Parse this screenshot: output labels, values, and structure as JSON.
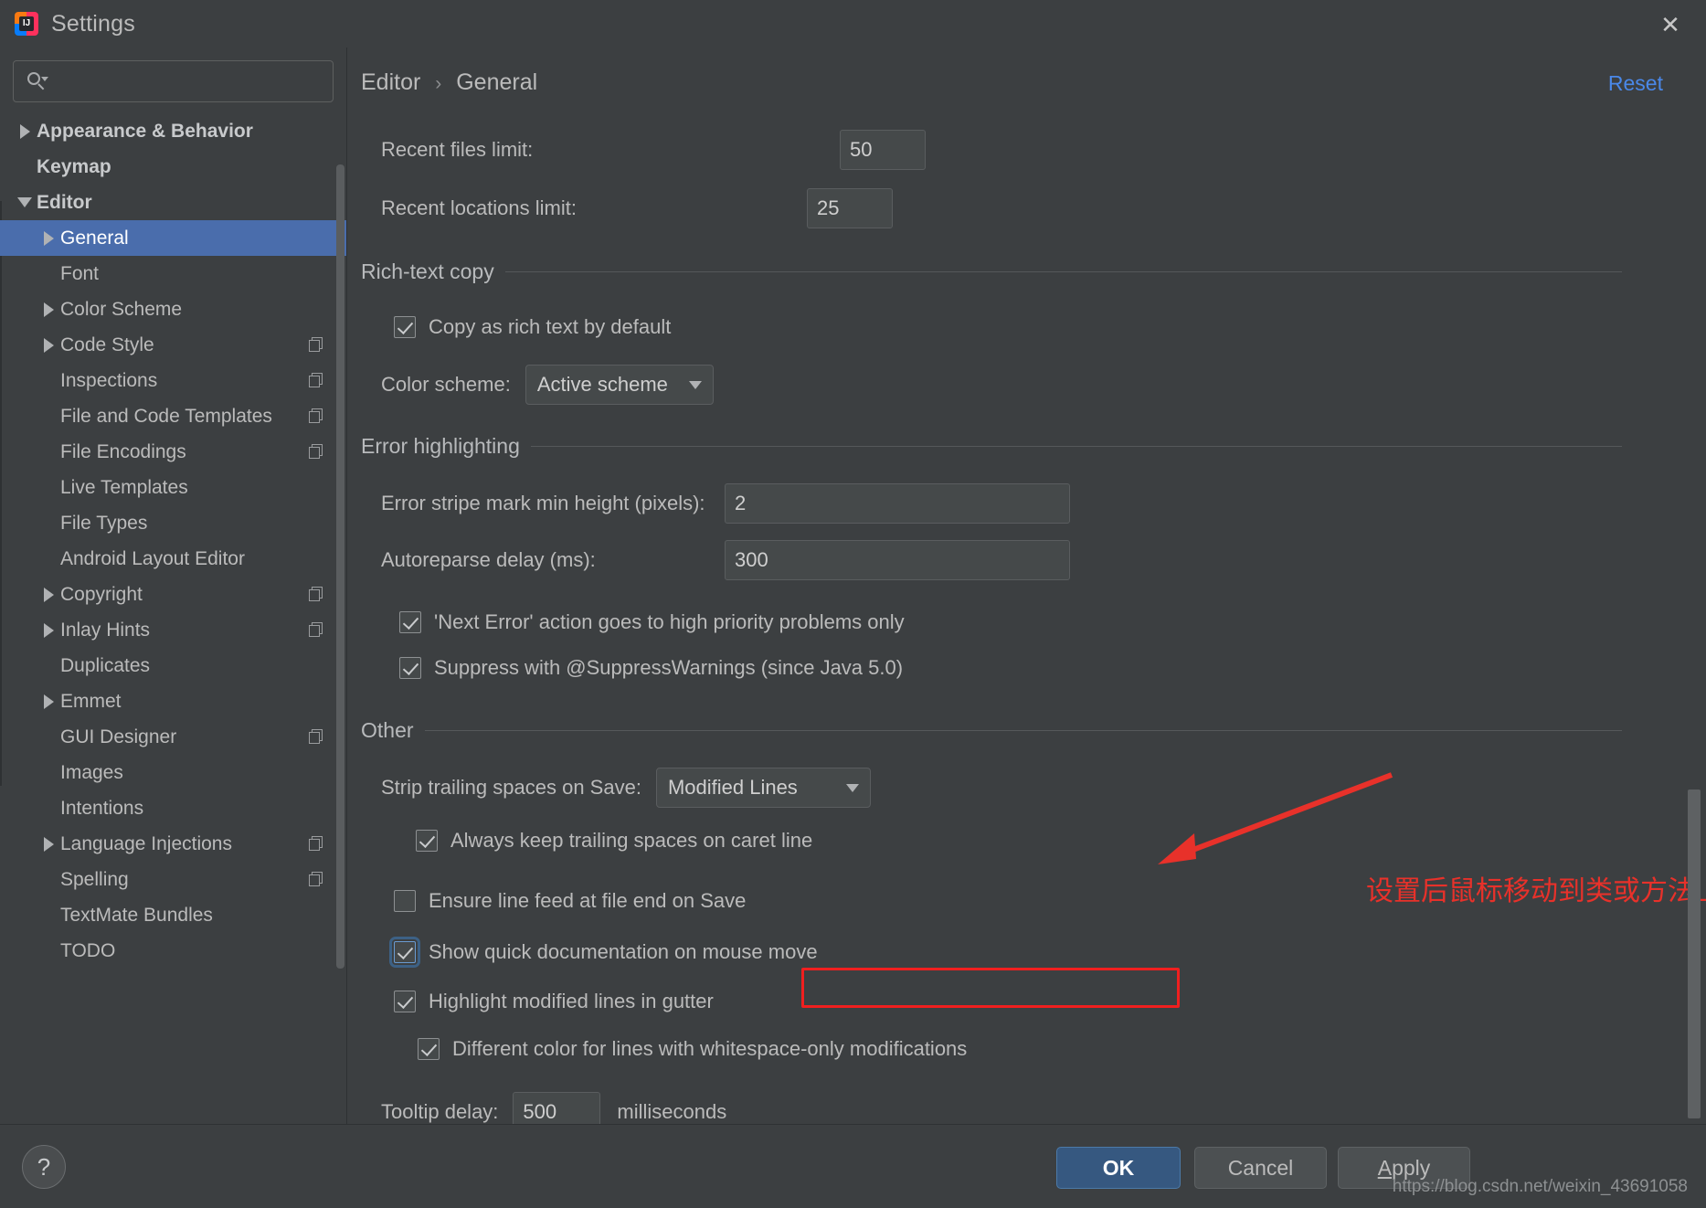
{
  "window": {
    "title": "Settings",
    "logo_letters": "IJ",
    "close_icon": "✕"
  },
  "sidebar": {
    "search": {
      "value": "",
      "placeholder": ""
    },
    "items": [
      {
        "label": "Appearance & Behavior",
        "indent": 0,
        "twisty": "right",
        "bold": true,
        "selected": false,
        "copyable": false
      },
      {
        "label": "Keymap",
        "indent": 0,
        "twisty": "none",
        "bold": true,
        "selected": false,
        "copyable": false
      },
      {
        "label": "Editor",
        "indent": 0,
        "twisty": "down",
        "bold": true,
        "selected": false,
        "copyable": false
      },
      {
        "label": "General",
        "indent": 1,
        "twisty": "right",
        "bold": false,
        "selected": true,
        "copyable": false
      },
      {
        "label": "Font",
        "indent": 1,
        "twisty": "none",
        "bold": false,
        "selected": false,
        "copyable": false
      },
      {
        "label": "Color Scheme",
        "indent": 1,
        "twisty": "right",
        "bold": false,
        "selected": false,
        "copyable": false
      },
      {
        "label": "Code Style",
        "indent": 1,
        "twisty": "right",
        "bold": false,
        "selected": false,
        "copyable": true
      },
      {
        "label": "Inspections",
        "indent": 1,
        "twisty": "none",
        "bold": false,
        "selected": false,
        "copyable": true
      },
      {
        "label": "File and Code Templates",
        "indent": 1,
        "twisty": "none",
        "bold": false,
        "selected": false,
        "copyable": true
      },
      {
        "label": "File Encodings",
        "indent": 1,
        "twisty": "none",
        "bold": false,
        "selected": false,
        "copyable": true
      },
      {
        "label": "Live Templates",
        "indent": 1,
        "twisty": "none",
        "bold": false,
        "selected": false,
        "copyable": false
      },
      {
        "label": "File Types",
        "indent": 1,
        "twisty": "none",
        "bold": false,
        "selected": false,
        "copyable": false
      },
      {
        "label": "Android Layout Editor",
        "indent": 1,
        "twisty": "none",
        "bold": false,
        "selected": false,
        "copyable": false
      },
      {
        "label": "Copyright",
        "indent": 1,
        "twisty": "right",
        "bold": false,
        "selected": false,
        "copyable": true
      },
      {
        "label": "Inlay Hints",
        "indent": 1,
        "twisty": "right",
        "bold": false,
        "selected": false,
        "copyable": true
      },
      {
        "label": "Duplicates",
        "indent": 1,
        "twisty": "none",
        "bold": false,
        "selected": false,
        "copyable": false
      },
      {
        "label": "Emmet",
        "indent": 1,
        "twisty": "right",
        "bold": false,
        "selected": false,
        "copyable": false
      },
      {
        "label": "GUI Designer",
        "indent": 1,
        "twisty": "none",
        "bold": false,
        "selected": false,
        "copyable": true
      },
      {
        "label": "Images",
        "indent": 1,
        "twisty": "none",
        "bold": false,
        "selected": false,
        "copyable": false
      },
      {
        "label": "Intentions",
        "indent": 1,
        "twisty": "none",
        "bold": false,
        "selected": false,
        "copyable": false
      },
      {
        "label": "Language Injections",
        "indent": 1,
        "twisty": "right",
        "bold": false,
        "selected": false,
        "copyable": true
      },
      {
        "label": "Spelling",
        "indent": 1,
        "twisty": "none",
        "bold": false,
        "selected": false,
        "copyable": true
      },
      {
        "label": "TextMate Bundles",
        "indent": 1,
        "twisty": "none",
        "bold": false,
        "selected": false,
        "copyable": false
      },
      {
        "label": "TODO",
        "indent": 1,
        "twisty": "none",
        "bold": false,
        "selected": false,
        "copyable": false
      }
    ]
  },
  "main": {
    "breadcrumb": {
      "parent": "Editor",
      "separator": "›",
      "current": "General"
    },
    "reset_label": "Reset",
    "recent_files": {
      "label": "Recent files limit:",
      "value": "50"
    },
    "recent_locations": {
      "label": "Recent locations limit:",
      "value": "25"
    },
    "rich_text_copy": {
      "title": "Rich-text copy",
      "copy_rich_text": {
        "label": "Copy as rich text by default",
        "checked": true
      },
      "color_scheme": {
        "label": "Color scheme:",
        "value": "Active scheme"
      }
    },
    "error_highlighting": {
      "title": "Error highlighting",
      "stripe_min_height": {
        "label": "Error stripe mark min height (pixels):",
        "value": "2"
      },
      "autoreparse_delay": {
        "label": "Autoreparse delay (ms):",
        "value": "300"
      },
      "next_error": {
        "label": "'Next Error' action goes to high priority problems only",
        "checked": true
      },
      "suppress_warnings": {
        "label": "Suppress with @SuppressWarnings (since Java 5.0)",
        "checked": true
      }
    },
    "other": {
      "title": "Other",
      "strip_trailing": {
        "label": "Strip trailing spaces on Save:",
        "value": "Modified Lines"
      },
      "keep_caret_spaces": {
        "label": "Always keep trailing spaces on caret line",
        "checked": true
      },
      "ensure_line_feed": {
        "label": "Ensure line feed at file end on Save",
        "checked": false
      },
      "show_quick_doc": {
        "label": "Show quick documentation on mouse move",
        "checked": true,
        "focused": true
      },
      "highlight_modified": {
        "label": "Highlight modified lines in gutter",
        "checked": true
      },
      "different_color_ws": {
        "label": "Different color for lines with whitespace-only modifications",
        "checked": true
      },
      "tooltip_delay": {
        "label": "Tooltip delay:",
        "value": "500",
        "unit": "milliseconds"
      }
    }
  },
  "annotation": {
    "text": "设置后鼠标移动到类或方法上，会给出提示",
    "color": "#e8312a"
  },
  "footer": {
    "help_icon": "?",
    "ok_label": "OK",
    "cancel_label": "Cancel",
    "apply_label_underlined": "A",
    "apply_label_rest": "pply",
    "watermark": "https://blog.csdn.net/weixin_43691058"
  },
  "colors": {
    "background": "#3c3f41",
    "selection": "#4a6dac",
    "link": "#4a88e8",
    "annotation_red": "#e8312a",
    "ok_button": "#365880"
  }
}
